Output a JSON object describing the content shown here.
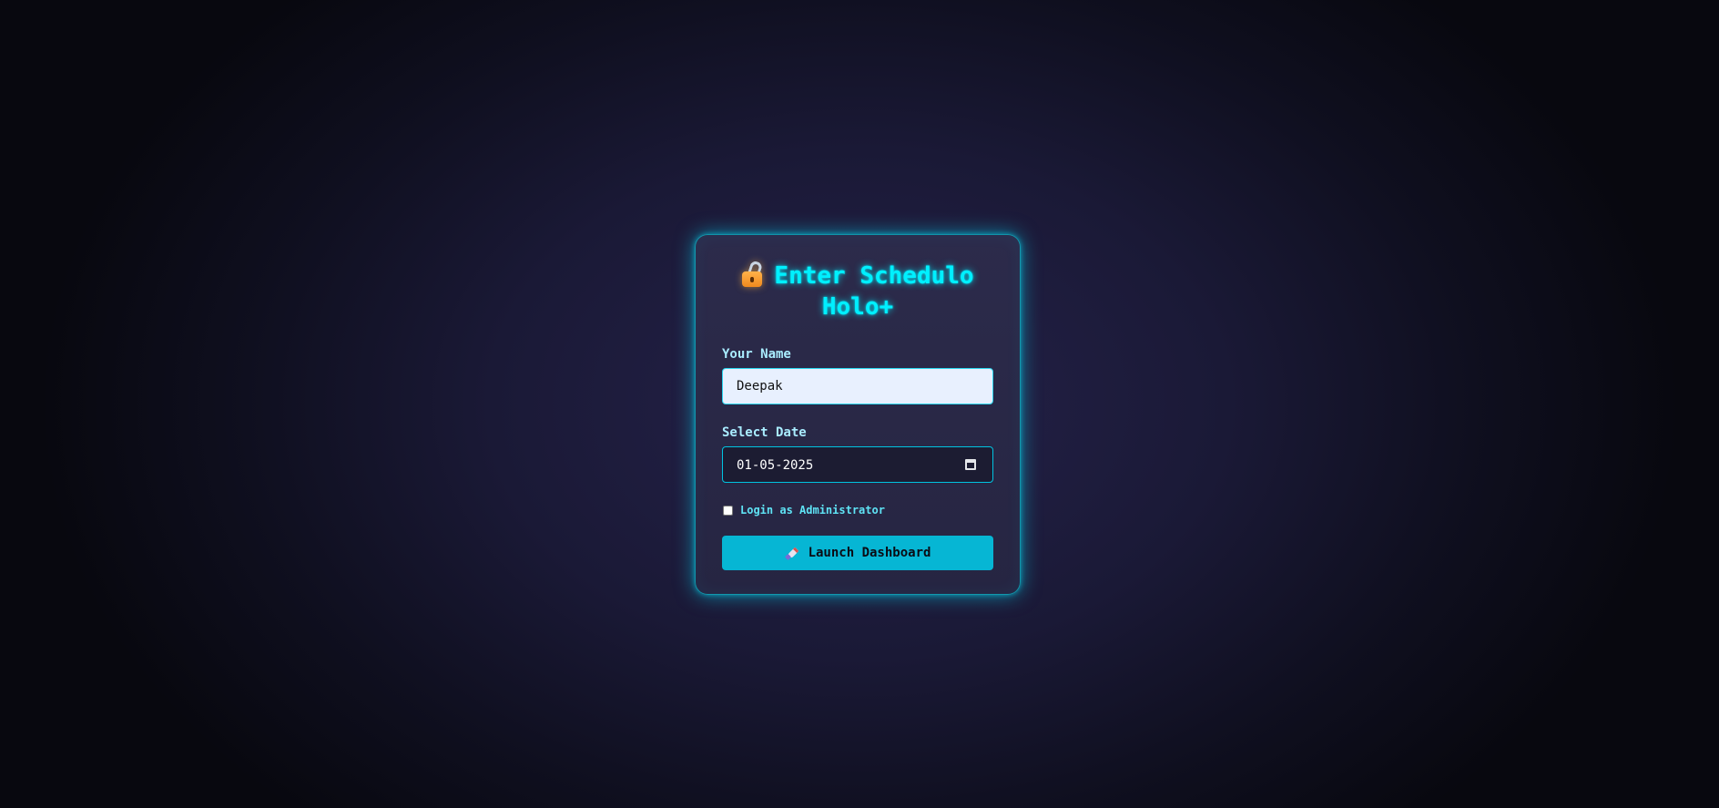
{
  "login_card": {
    "title": "Enter Schedulo Holo+",
    "title_icon": "lock-icon",
    "name_label": "Your Name",
    "name_value": "Deepak",
    "date_label": "Select Date",
    "date_value": "01-05-2025",
    "admin_checked": false,
    "admin_label": "Login as Administrator",
    "launch_button_label": "Launch Dashboard",
    "launch_button_icon": "rocket-icon"
  },
  "colors": {
    "accent": "#00f0ff",
    "button_bg": "#06b6d4",
    "card_bg": "#2a2946",
    "page_bg": "#1a1936"
  }
}
